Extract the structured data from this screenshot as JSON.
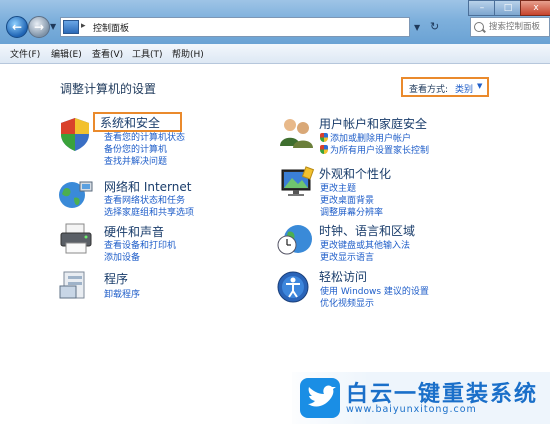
{
  "address": {
    "path": "控制面板"
  },
  "search": {
    "placeholder": "搜索控制面板"
  },
  "window_buttons": {
    "min": "–",
    "max": "□",
    "close": "x"
  },
  "menu": [
    {
      "label": "文件(F)"
    },
    {
      "label": "编辑(E)"
    },
    {
      "label": "查看(V)"
    },
    {
      "label": "工具(T)"
    },
    {
      "label": "帮助(H)"
    }
  ],
  "main": {
    "title": "调整计算机的设置",
    "view_by": {
      "label": "查看方式:",
      "value": "类别"
    }
  },
  "categories": [
    {
      "title": "系统和安全",
      "icon": "system-security-icon",
      "links": [
        {
          "label": "查看您的计算机状态"
        },
        {
          "label": "备份您的计算机"
        },
        {
          "label": "查找并解决问题"
        }
      ]
    },
    {
      "title": "网络和 Internet",
      "icon": "network-globe-icon",
      "links": [
        {
          "label": "查看网络状态和任务"
        },
        {
          "label": "选择家庭组和共享选项"
        }
      ]
    },
    {
      "title": "硬件和声音",
      "icon": "printer-icon",
      "links": [
        {
          "label": "查看设备和打印机"
        },
        {
          "label": "添加设备"
        }
      ]
    },
    {
      "title": "程序",
      "icon": "programs-icon",
      "links": [
        {
          "label": "卸载程序"
        }
      ]
    },
    {
      "title": "用户帐户和家庭安全",
      "icon": "users-icon",
      "links": [
        {
          "label": "添加或删除用户帐户",
          "shield": true
        },
        {
          "label": "为所有用户设置家长控制",
          "shield": true
        }
      ]
    },
    {
      "title": "外观和个性化",
      "icon": "appearance-monitor-icon",
      "links": [
        {
          "label": "更改主题"
        },
        {
          "label": "更改桌面背景"
        },
        {
          "label": "调整屏幕分辨率"
        }
      ]
    },
    {
      "title": "时钟、语言和区域",
      "icon": "clock-globe-icon",
      "links": [
        {
          "label": "更改键盘或其他输入法"
        },
        {
          "label": "更改显示语言"
        }
      ]
    },
    {
      "title": "轻松访问",
      "icon": "ease-of-access-icon",
      "links": [
        {
          "label": "使用 Windows 建议的设置"
        },
        {
          "label": "优化视频显示"
        }
      ]
    }
  ],
  "watermark": {
    "title": "白云一键重装系统",
    "url": "www.baiyunxitong.com"
  }
}
